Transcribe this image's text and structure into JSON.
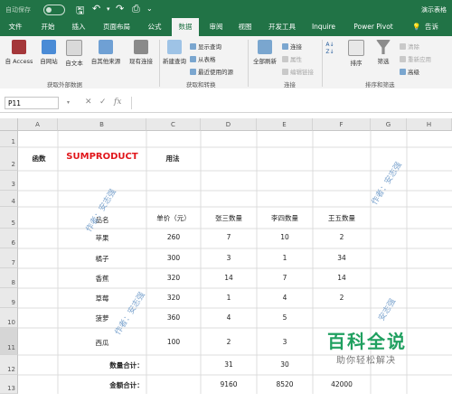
{
  "titlebar": {
    "autosave": "自动保存",
    "toggle": "关",
    "doc_title": "演示表格"
  },
  "tabs": [
    "文件",
    "开始",
    "插入",
    "页面布局",
    "公式",
    "数据",
    "审阅",
    "视图",
    "开发工具",
    "Inquire",
    "Power Pivot"
  ],
  "active_tab": "数据",
  "search_hint": "告诉",
  "ribbon": {
    "get_external": {
      "buttons": [
        "自 Access",
        "自网站",
        "自文本",
        "自其他来源",
        "现有连接"
      ],
      "group": "获取外部数据"
    },
    "transform": {
      "new_query": "新建查询",
      "small": [
        "显示查询",
        "从表格",
        "最近使用的源"
      ],
      "group": "获取和转换"
    },
    "connections": {
      "refresh_all": "全部刷新",
      "small": [
        "连接",
        "属性",
        "编辑链接"
      ],
      "group": "连接"
    },
    "sort_filter": {
      "sort": "排序",
      "filter": "筛选",
      "small": [
        "清除",
        "重新应用",
        "高级"
      ],
      "group": "排序和筛选"
    }
  },
  "formula_bar": {
    "name_box": "P11",
    "cancel": "✕",
    "confirm": "✓",
    "fx": "fx",
    "content": ""
  },
  "columns": [
    "A",
    "B",
    "C",
    "D",
    "E",
    "F",
    "G",
    "H"
  ],
  "rows": [
    "1",
    "2",
    "3",
    "4",
    "5",
    "6",
    "7",
    "8",
    "9",
    "10",
    "11",
    "12",
    "13"
  ],
  "sheet": {
    "row2": {
      "a": "函数",
      "b": "SUMPRODUCT",
      "c": "用法"
    },
    "headers": {
      "item": "品名",
      "price": "单价（元）",
      "zhang": "张三数量",
      "li": "李四数量",
      "wang": "王五数量"
    },
    "items": [
      {
        "name": "苹果",
        "price": "260",
        "zhang": "7",
        "li": "10",
        "wang": "2"
      },
      {
        "name": "橘子",
        "price": "300",
        "zhang": "3",
        "li": "1",
        "wang": "34"
      },
      {
        "name": "香蕉",
        "price": "320",
        "zhang": "14",
        "li": "7",
        "wang": "14"
      },
      {
        "name": "草莓",
        "price": "320",
        "zhang": "1",
        "li": "4",
        "wang": "2"
      },
      {
        "name": "菠萝",
        "price": "360",
        "zhang": "4",
        "li": "5",
        "wang": ""
      },
      {
        "name": "西瓜",
        "price": "100",
        "zhang": "2",
        "li": "3",
        "wang": ""
      }
    ],
    "qty_total": {
      "label": "数量合计：",
      "zhang": "31",
      "li": "30",
      "wang": ""
    },
    "amount_total": {
      "label": "金额合计：",
      "zhang": "9160",
      "li": "8520",
      "wang": "42000"
    }
  },
  "watermarks": [
    "作者：安志强",
    "作者：安志强",
    "作者：安志强",
    "安志强"
  ],
  "logo": {
    "title": "百科全说",
    "subtitle": "助你轻松解决"
  },
  "colors": {
    "excel_green": "#217346",
    "accent_red": "#e1161b",
    "watermark_blue": "#7fa6cf",
    "logo_green": "#20a060"
  }
}
